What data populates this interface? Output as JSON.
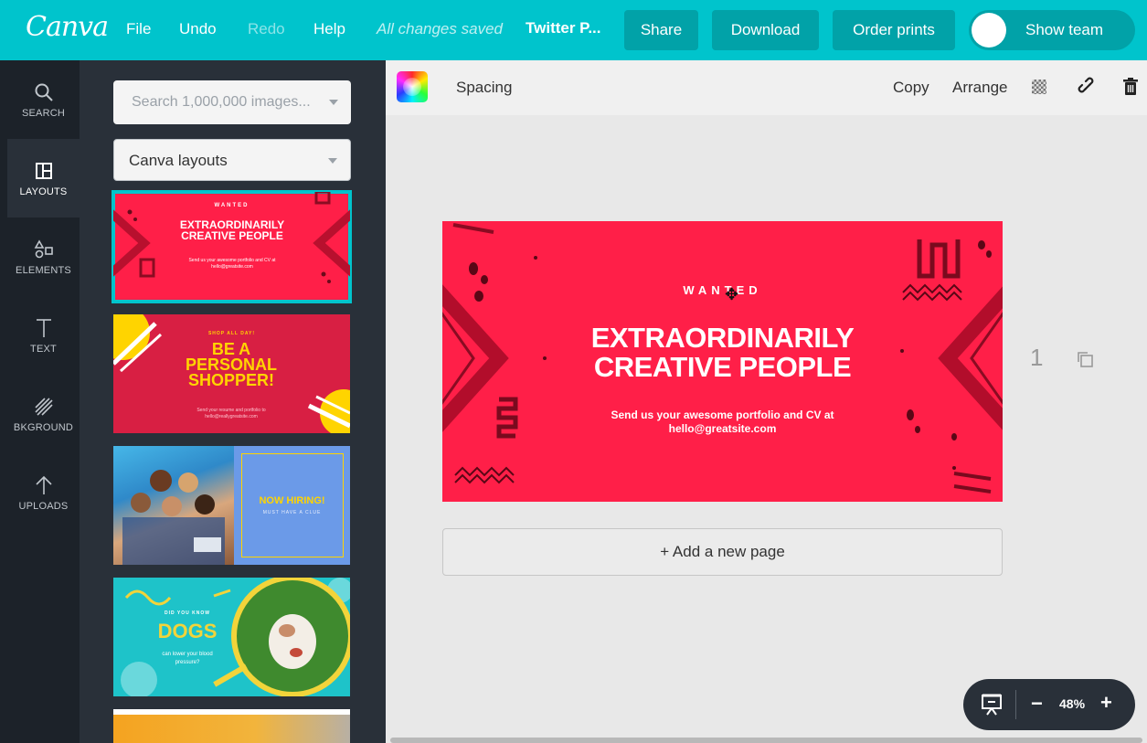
{
  "topbar": {
    "logo": "Canva",
    "menu": [
      "File",
      "Undo",
      "Redo",
      "Help"
    ],
    "saved_status": "All changes saved",
    "doc_title": "Twitter P...",
    "share_label": "Share",
    "download_label": "Download",
    "order_prints_label": "Order prints",
    "show_team_label": "Show team",
    "colors": {
      "bar": "#00c4cc",
      "button": "#01a2a8"
    }
  },
  "rail": {
    "items": [
      {
        "label": "SEARCH",
        "icon": "search-icon"
      },
      {
        "label": "LAYOUTS",
        "icon": "layouts-icon"
      },
      {
        "label": "ELEMENTS",
        "icon": "elements-icon"
      },
      {
        "label": "TEXT",
        "icon": "text-icon"
      },
      {
        "label": "BKGROUND",
        "icon": "background-icon"
      },
      {
        "label": "UPLOADS",
        "icon": "upload-icon"
      }
    ]
  },
  "panel": {
    "search_placeholder": "Search 1,000,000 images...",
    "layout_select_value": "Canva layouts",
    "thumbnails": [
      {
        "kicker": "WANTED",
        "title": "EXTRAORDINARILY CREATIVE PEOPLE",
        "body": "Send us your awesome portfolio and CV at hello@greatsite.com"
      },
      {
        "kicker": "SHOP ALL DAY!",
        "title": "BE A PERSONAL SHOPPER!",
        "body": "Send your resume and portfolio to hello@reallygreatsite.com"
      },
      {
        "title": "NOW HIRING!",
        "body": "MUST HAVE A CLUE"
      },
      {
        "kicker": "DID YOU KNOW",
        "title": "DOGS",
        "body": "can lower your blood pressure?"
      }
    ]
  },
  "toolbar": {
    "spacing_label": "Spacing",
    "copy_label": "Copy",
    "arrange_label": "Arrange"
  },
  "canvas": {
    "background": "#ff1f48",
    "kicker": "WANTED",
    "title_line1": "EXTRAORDINARILY",
    "title_line2": "CREATIVE PEOPLE",
    "subtitle_line1": "Send us your awesome portfolio and CV at",
    "subtitle_line2": "hello@greatsite.com",
    "page_number": "1",
    "add_page_label": "+ Add a new page"
  },
  "zoom": {
    "minus": "−",
    "value": "48%",
    "plus": "+"
  }
}
